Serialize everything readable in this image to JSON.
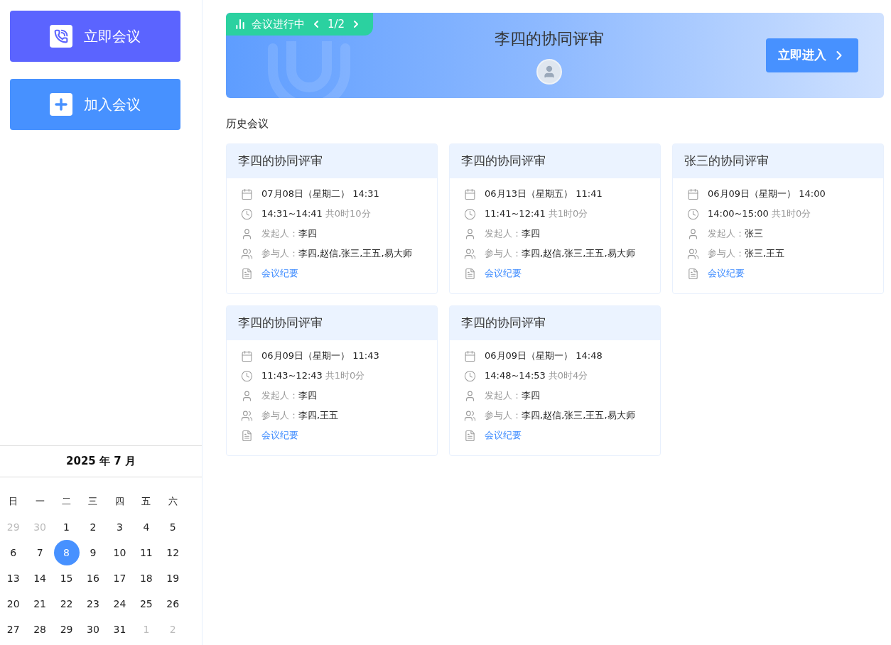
{
  "sidebar": {
    "actions": [
      {
        "kind": "start",
        "label": "立即会议"
      },
      {
        "kind": "join",
        "label": "加入会议"
      }
    ],
    "calendar": {
      "title": "2025 年 7 月",
      "weekdays": [
        "日",
        "一",
        "二",
        "三",
        "四",
        "五",
        "六"
      ],
      "days": [
        {
          "label": "29",
          "outside": true,
          "selected": false
        },
        {
          "label": "30",
          "outside": true,
          "selected": false
        },
        {
          "label": "1",
          "outside": false,
          "selected": false
        },
        {
          "label": "2",
          "outside": false,
          "selected": false
        },
        {
          "label": "3",
          "outside": false,
          "selected": false
        },
        {
          "label": "4",
          "outside": false,
          "selected": false
        },
        {
          "label": "5",
          "outside": false,
          "selected": false
        },
        {
          "label": "6",
          "outside": false,
          "selected": false
        },
        {
          "label": "7",
          "outside": false,
          "selected": false
        },
        {
          "label": "8",
          "outside": false,
          "selected": true
        },
        {
          "label": "9",
          "outside": false,
          "selected": false
        },
        {
          "label": "10",
          "outside": false,
          "selected": false
        },
        {
          "label": "11",
          "outside": false,
          "selected": false
        },
        {
          "label": "12",
          "outside": false,
          "selected": false
        },
        {
          "label": "13",
          "outside": false,
          "selected": false
        },
        {
          "label": "14",
          "outside": false,
          "selected": false
        },
        {
          "label": "15",
          "outside": false,
          "selected": false
        },
        {
          "label": "16",
          "outside": false,
          "selected": false
        },
        {
          "label": "17",
          "outside": false,
          "selected": false
        },
        {
          "label": "18",
          "outside": false,
          "selected": false
        },
        {
          "label": "19",
          "outside": false,
          "selected": false
        },
        {
          "label": "20",
          "outside": false,
          "selected": false
        },
        {
          "label": "21",
          "outside": false,
          "selected": false
        },
        {
          "label": "22",
          "outside": false,
          "selected": false
        },
        {
          "label": "23",
          "outside": false,
          "selected": false
        },
        {
          "label": "24",
          "outside": false,
          "selected": false
        },
        {
          "label": "25",
          "outside": false,
          "selected": false
        },
        {
          "label": "26",
          "outside": false,
          "selected": false
        },
        {
          "label": "27",
          "outside": false,
          "selected": false
        },
        {
          "label": "28",
          "outside": false,
          "selected": false
        },
        {
          "label": "29",
          "outside": false,
          "selected": false
        },
        {
          "label": "30",
          "outside": false,
          "selected": false
        },
        {
          "label": "31",
          "outside": false,
          "selected": false
        },
        {
          "label": "1",
          "outside": true,
          "selected": false
        },
        {
          "label": "2",
          "outside": true,
          "selected": false
        }
      ]
    }
  },
  "banner": {
    "status": "会议进行中",
    "pager": "1/2",
    "title": "李四的协同评审",
    "enter_button": "立即进入"
  },
  "history": {
    "heading": "历史会议",
    "meetings": [
      {
        "title": "李四的协同评审",
        "date": "07月08日（星期二） 14:31",
        "time": "14:31~14:41",
        "duration": "共0时10分",
        "host_label": "发起人：",
        "host": "李四",
        "participants_label": "参与人：",
        "participants": "李四,赵信,张三,王五,易大师",
        "minutes": "会议纪要"
      },
      {
        "title": "李四的协同评审",
        "date": "06月13日（星期五） 11:41",
        "time": "11:41~12:41",
        "duration": "共1时0分",
        "host_label": "发起人：",
        "host": "李四",
        "participants_label": "参与人：",
        "participants": "李四,赵信,张三,王五,易大师",
        "minutes": "会议纪要"
      },
      {
        "title": "张三的协同评审",
        "date": "06月09日（星期一） 14:00",
        "time": "14:00~15:00",
        "duration": "共1时0分",
        "host_label": "发起人：",
        "host": "张三",
        "participants_label": "参与人：",
        "participants": "张三,王五",
        "minutes": "会议纪要"
      },
      {
        "title": "李四的协同评审",
        "date": "06月09日（星期一） 11:43",
        "time": "11:43~12:43",
        "duration": "共1时0分",
        "host_label": "发起人：",
        "host": "李四",
        "participants_label": "参与人：",
        "participants": "李四,王五",
        "minutes": "会议纪要"
      },
      {
        "title": "李四的协同评审",
        "date": "06月09日（星期一） 14:48",
        "time": "14:48~14:53",
        "duration": "共0时4分",
        "host_label": "发起人：",
        "host": "李四",
        "participants_label": "参与人：",
        "participants": "李四,赵信,张三,王五,易大师",
        "minutes": "会议纪要"
      }
    ]
  }
}
